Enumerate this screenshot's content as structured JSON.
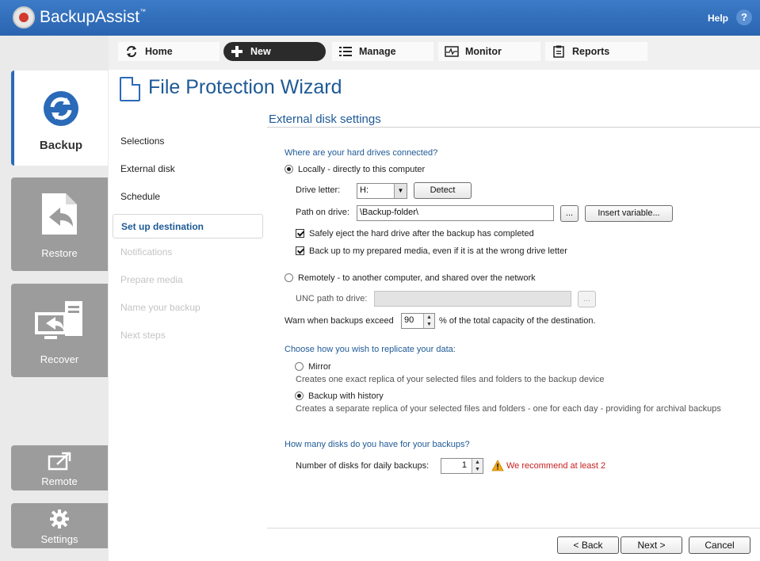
{
  "app": {
    "logo_text": "BackupAssist",
    "logo_tm": "™",
    "help_label": "Help",
    "help_icon": "?"
  },
  "nav": {
    "home": "Home",
    "new": "New",
    "manage": "Manage",
    "monitor": "Monitor",
    "reports": "Reports"
  },
  "sidebar": {
    "backup": "Backup",
    "restore": "Restore",
    "recover": "Recover",
    "remote": "Remote",
    "settings": "Settings"
  },
  "wizard": {
    "title": "File Protection Wizard",
    "steps": [
      {
        "label": "Selections",
        "state": "done"
      },
      {
        "label": "External disk",
        "state": "done"
      },
      {
        "label": "Schedule",
        "state": "done"
      },
      {
        "label": "Set up destination",
        "state": "current"
      },
      {
        "label": "Notifications",
        "state": "disabled"
      },
      {
        "label": "Prepare media",
        "state": "disabled"
      },
      {
        "label": "Name your backup",
        "state": "disabled"
      },
      {
        "label": "Next steps",
        "state": "disabled"
      }
    ]
  },
  "settings": {
    "section_title": "External disk settings",
    "q_connected": "Where are your hard drives connected?",
    "locally_label": "Locally - directly to this computer",
    "drive_letter_label": "Drive letter:",
    "drive_letter_value": "H:",
    "detect_button": "Detect",
    "path_label": "Path on drive:",
    "path_value": "\\Backup-folder\\",
    "browse_button": "...",
    "insert_variable_button": "Insert variable...",
    "safely_eject_label": "Safely eject the hard drive after the backup has completed",
    "safely_eject_checked": true,
    "prepared_media_label": "Back up to my prepared media, even if it is at the wrong drive letter",
    "prepared_media_checked": true,
    "remotely_label": "Remotely - to another computer, and shared over the network",
    "unc_label": "UNC path to drive:",
    "unc_value": "",
    "unc_browse_button": "...",
    "warn_prefix": "Warn when backups exceed",
    "warn_value": "90",
    "warn_suffix": "% of the total capacity of the destination.",
    "q_replicate": "Choose how you wish to replicate your data:",
    "mirror_label": "Mirror",
    "mirror_desc": "Creates one exact replica of your selected files and folders to the backup device",
    "history_label": "Backup with history",
    "history_desc": "Creates a separate replica of your selected files and folders - one for each day - providing for archival backups",
    "q_disks": "How many disks do you have for your backups?",
    "disks_label": "Number of disks for daily backups:",
    "disks_value": "1",
    "disks_warning": "We recommend at least 2"
  },
  "footer": {
    "back": "< Back",
    "next": "Next >",
    "cancel": "Cancel"
  },
  "colors": {
    "accent": "#1e5a96",
    "titlebar": "#2a64b0",
    "warning": "#c81e1e"
  }
}
